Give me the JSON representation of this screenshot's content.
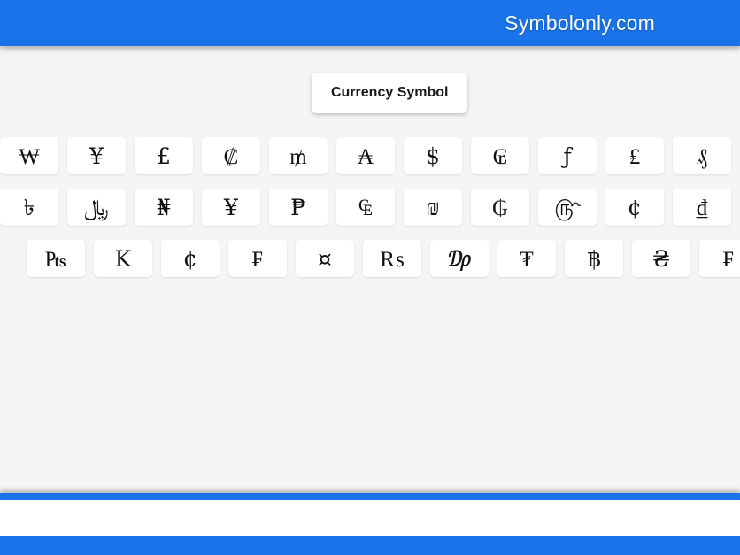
{
  "header": {
    "site_title": "Symbolonly.com",
    "background_color": "#1a73e8",
    "text_color": "#ffffff"
  },
  "tabs": [
    {
      "label": "Currency Symbol",
      "active": true
    }
  ],
  "page": {
    "background_color": "#f5f5f5",
    "tile_background_color": "#ffffff",
    "accent_color": "#1a73e8"
  },
  "symbol_grid": {
    "rows": [
      {
        "indented": false,
        "symbols": [
          {
            "glyph": "₩",
            "name": "won-sign"
          },
          {
            "glyph": "¥",
            "name": "yen-sign"
          },
          {
            "glyph": "£",
            "name": "pound-sign"
          },
          {
            "glyph": "₡",
            "name": "colon-sign"
          },
          {
            "glyph": "₥",
            "name": "mill-sign"
          },
          {
            "glyph": "₳",
            "name": "austral-sign"
          },
          {
            "glyph": "$",
            "name": "dollar-sign"
          },
          {
            "glyph": "₢",
            "name": "cruzeiro-sign"
          },
          {
            "glyph": "ƒ",
            "name": "florin-sign"
          },
          {
            "glyph": "₤",
            "name": "lira-sign"
          },
          {
            "glyph": "₰",
            "name": "pfennig-sign"
          }
        ]
      },
      {
        "indented": false,
        "symbols": [
          {
            "glyph": "৳",
            "name": "bengali-taka-sign"
          },
          {
            "glyph": "﷼",
            "name": "rial-sign"
          },
          {
            "glyph": "₦",
            "name": "naira-sign"
          },
          {
            "glyph": "¥",
            "name": "yen-sign"
          },
          {
            "glyph": "₱",
            "name": "peso-sign"
          },
          {
            "glyph": "₠",
            "name": "euro-currency-sign"
          },
          {
            "glyph": "₪",
            "name": "new-sheqel-sign"
          },
          {
            "glyph": "₲",
            "name": "guarani-sign"
          },
          {
            "glyph": "௹",
            "name": "tamil-rupee-sign"
          },
          {
            "glyph": "¢",
            "name": "cent-sign"
          },
          {
            "glyph": "₫",
            "name": "dong-sign"
          }
        ]
      },
      {
        "indented": true,
        "symbols": [
          {
            "glyph": "₧",
            "name": "peseta-sign"
          },
          {
            "glyph": "K",
            "name": "kip-sign"
          },
          {
            "glyph": "¢",
            "name": "cent-sign"
          },
          {
            "glyph": "₣",
            "name": "french-franc-sign"
          },
          {
            "glyph": "¤",
            "name": "generic-currency-sign"
          },
          {
            "glyph": "₨",
            "name": "rupee-sign"
          },
          {
            "glyph": "₯",
            "name": "drachma-sign"
          },
          {
            "glyph": "₮",
            "name": "tugrik-sign"
          },
          {
            "glyph": "฿",
            "name": "baht-sign"
          },
          {
            "glyph": "₴",
            "name": "hryvnia-sign"
          },
          {
            "glyph": "₣",
            "name": "french-franc-sign"
          }
        ]
      }
    ]
  }
}
